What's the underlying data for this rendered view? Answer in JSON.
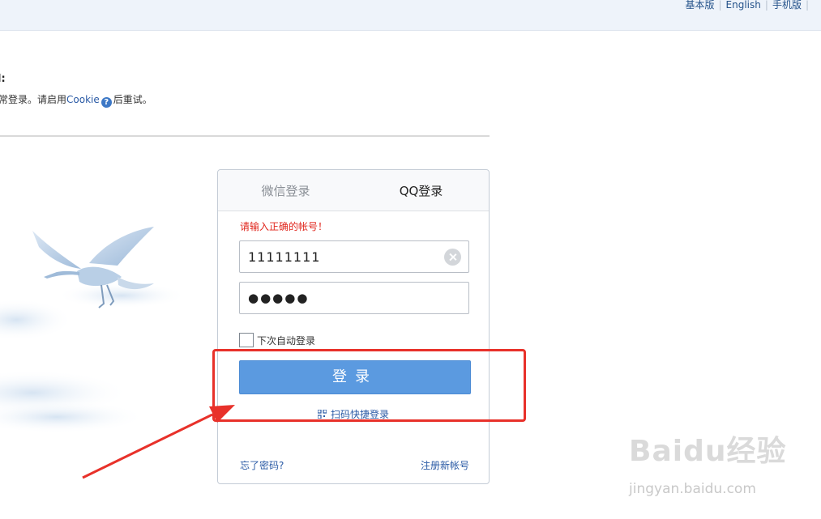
{
  "toplinks": [
    "基本版",
    "English",
    "手机版"
  ],
  "notice": {
    "title_fragment": "l:",
    "text_before": "常登录。请启用",
    "cookie_link": "Cookie",
    "help_symbol": "?",
    "text_after": "后重试。"
  },
  "login": {
    "tabs": [
      "微信登录",
      "QQ登录"
    ],
    "active_tab": "QQ登录",
    "error": "请输入正确的帐号！",
    "username_value": "11111111",
    "password_masked": "●●●●●",
    "auto_login_label": "下次自动登录",
    "auto_login_checked": false,
    "login_button": "登录",
    "qr_login": "扫码快捷登录",
    "forgot_password": "忘了密码?",
    "register": "注册新帐号"
  },
  "icons": {
    "clear": "clear-icon",
    "help": "help-icon",
    "qr": "qr-code-icon",
    "checkbox": "checkbox-icon"
  },
  "colors": {
    "login_button": "#5b9ae0",
    "error_text": "#e0241b",
    "link": "#2a5aa5",
    "annotation": "#e8312a"
  },
  "watermark": {
    "brand": "Baidu经验",
    "url": "jingyan.baidu.com"
  }
}
